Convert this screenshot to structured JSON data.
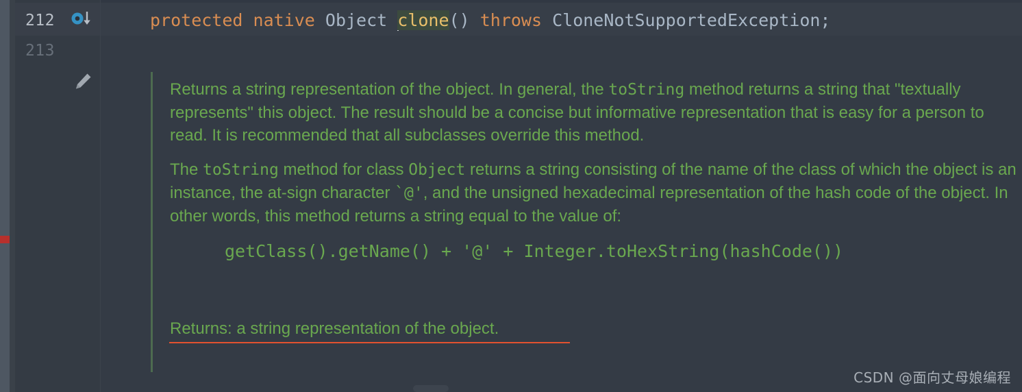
{
  "editor": {
    "gutter": {
      "line_numbers": [
        "212",
        "213"
      ],
      "implement_marker_icon": "override-method-icon",
      "edit_pencil_icon": "pencil-icon"
    },
    "code_line": {
      "tokens": [
        {
          "text": "protected",
          "kind": "keyword"
        },
        {
          "text": " ",
          "kind": "plain"
        },
        {
          "text": "native",
          "kind": "keyword"
        },
        {
          "text": " ",
          "kind": "plain"
        },
        {
          "text": "Object",
          "kind": "type"
        },
        {
          "text": " ",
          "kind": "plain"
        },
        {
          "text": "clone",
          "kind": "method-selected"
        },
        {
          "text": "()",
          "kind": "punct"
        },
        {
          "text": " ",
          "kind": "plain"
        },
        {
          "text": "throws",
          "kind": "keyword"
        },
        {
          "text": " ",
          "kind": "plain"
        },
        {
          "text": "CloneNotSupportedException;",
          "kind": "type"
        }
      ],
      "full_text": "protected native Object clone() throws CloneNotSupportedException;"
    },
    "error_stripe_marker": "error-marker"
  },
  "doc_popup": {
    "paragraph_1": {
      "part_1": "Returns a string representation of the object. In general, the ",
      "code_1": "toString",
      "part_2": " method returns a string that \"textually represents\" this object. The result should be a concise but informative representation that is easy for a person to read. It is recommended that all subclasses override this method."
    },
    "paragraph_2": {
      "part_1": "The ",
      "code_1": "toString",
      "part_2": " method for class ",
      "code_2": "Object",
      "part_3": " returns a string consisting of the name of the class of which the object is an instance, the at-sign character ",
      "code_3": "`@'",
      "part_4": ", and the unsigned hexadecimal representation of the hash code of the object. In other words, this method returns a string equal to the value of:"
    },
    "code_block": "getClass().getName() + '@' + Integer.toHexString(hashCode())",
    "returns_label": "Returns:",
    "returns_value": " a string representation of the object."
  },
  "watermark": {
    "text": "CSDN @面向丈母娘编程"
  },
  "colors": {
    "editor_background": "#313843",
    "gutter_background": "#343b44",
    "doc_background": "#343b45",
    "doc_text_green": "#6aa84f",
    "keyword_orange": "#d98d52",
    "type_gray": "#a9b7c6",
    "method_yellow": "#e8bf6a",
    "selection_green": "#3c4b3e",
    "error_red": "#b7302c",
    "underline_red": "#e3522f",
    "marker_blue": "#3592c4"
  }
}
